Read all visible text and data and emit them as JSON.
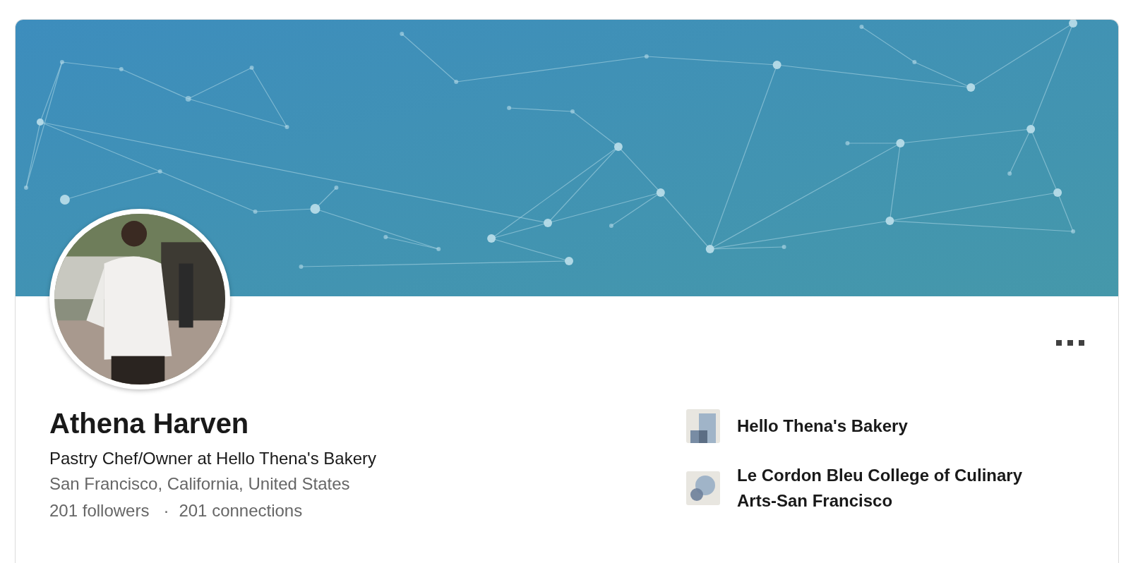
{
  "profile": {
    "name": "Athena Harven",
    "headline": "Pastry Chef/Owner at Hello Thena's Bakery",
    "location": "San Francisco, California, United States",
    "followers": "201 followers",
    "separator": "·",
    "connections": "201 connections"
  },
  "organizations": [
    {
      "kind": "company",
      "name": "Hello Thena's Bakery"
    },
    {
      "kind": "school",
      "name": "Le Cordon Bleu College of Culinary Arts-San Francisco"
    }
  ]
}
